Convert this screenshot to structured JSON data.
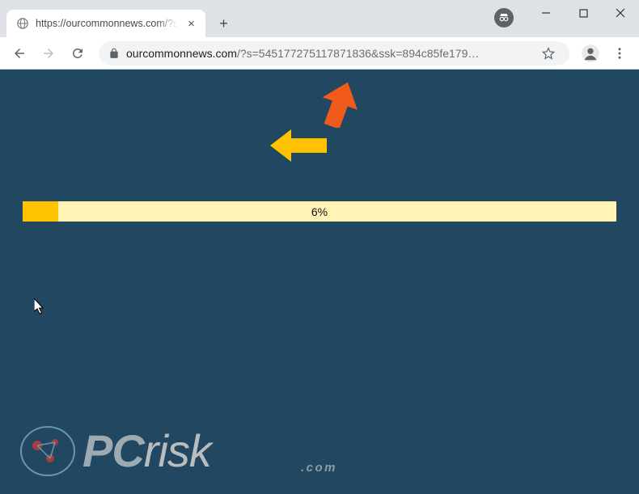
{
  "titlebar": {
    "tab_title": "https://ourcommonnews.com/?s",
    "close_glyph": "×",
    "newtab_glyph": "+"
  },
  "toolbar": {
    "url_domain": "ourcommonnews.com",
    "url_rest": "/?s=545177275117871836&ssk=894c85fe179…"
  },
  "content": {
    "progress_percent": 6,
    "progress_label": "6%"
  },
  "watermark": {
    "brand1": "PC",
    "brand2": "risk",
    "sub": ".com"
  },
  "colors": {
    "page_bg": "#214761",
    "progress_track": "#fff3b6",
    "progress_fill": "#ffc200",
    "arrow_orange": "#f05a1a",
    "arrow_yellow": "#ffc200"
  }
}
